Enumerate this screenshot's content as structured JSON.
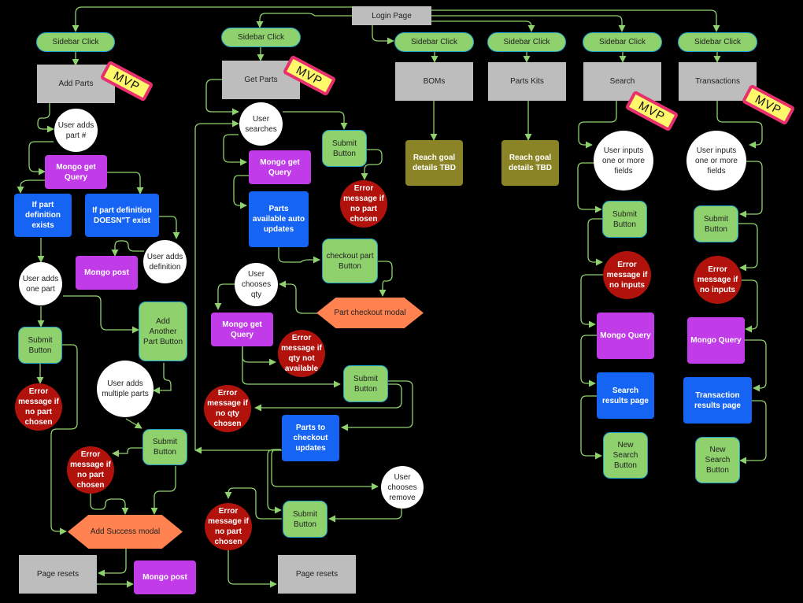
{
  "diagram": {
    "title": "Login Page",
    "colors": {
      "background": "#000000",
      "edge": "#8fd16c",
      "pill": "#8fd16c",
      "pill_border": "#1aa0c8",
      "page": "#bdbdbd",
      "mongo": "#c23be8",
      "blue": "#1664f4",
      "error": "#b1120c",
      "olive": "#8a8426",
      "modal": "#ff8250",
      "mvp_fill": "#fff86a",
      "mvp_border": "#e8306e"
    },
    "mvp_label": "MVP",
    "nodes": {
      "login": "Login Page",
      "sb1": "Sidebar Click",
      "sb2": "Sidebar Click",
      "sb3": "Sidebar Click",
      "sb4": "Sidebar Click",
      "sb5": "Sidebar Click",
      "sb6": "Sidebar Click",
      "add_parts": "Add Parts",
      "get_parts": "Get Parts",
      "boms": "BOMs",
      "parts_kits": "Parts Kits",
      "search": "Search",
      "transactions": "Transactions",
      "a_user_adds_part": "User adds part #",
      "a_mongo_get": "Mongo get Query",
      "a_if_exists": "If part definition exists",
      "a_if_not_exists": "If part definition DOESN\"T exist",
      "a_mongo_post1": "Mongo post",
      "a_user_adds_def": "User adds definition",
      "a_user_adds_one": "User adds one part",
      "a_submit1": "Submit Button",
      "a_add_another": "Add Another Part Button",
      "a_err1": "Error message if no part chosen",
      "a_user_adds_multi": "User adds multiple parts",
      "a_submit2": "Submit Button",
      "a_err2": "Error message if no part chosen",
      "a_success_modal": "Add Success modal",
      "a_page_resets": "Page resets",
      "a_mongo_post2": "Mongo post",
      "g_user_searches": "User searches",
      "g_submit1": "Submit Button",
      "g_err1": "Error message if no part chosen",
      "g_mongo_get1": "Mongo get Query",
      "g_parts_avail": "Parts available auto updates",
      "g_checkout_btn": "checkout part Button",
      "g_user_qty": "User chooses qty",
      "g_checkout_modal": "Part checkout modal",
      "g_mongo_get2": "Mongo get Query",
      "g_err_qty": "Error message if qty not available",
      "g_submit2": "Submit Button",
      "g_err_noqty": "Error message if no qty chosen",
      "g_parts_checkout": "Parts to checkout updates",
      "g_user_remove": "User chooses remove",
      "g_submit3": "Submit Button",
      "g_err3": "Error message if no part chosen",
      "g_page_resets": "Page resets",
      "b_goal": "Reach goal details TBD",
      "k_goal": "Reach goal details TBD",
      "s_inputs": "User inputs one or more fields",
      "s_submit": "Submit Button",
      "s_err": "Error message if no inputs",
      "s_mongo": "Mongo Query",
      "s_results": "Search results page",
      "s_new": "New Search Button",
      "t_inputs": "User inputs one or more fields",
      "t_submit": "Submit Button",
      "t_err": "Error message if no inputs",
      "t_mongo": "Mongo Query",
      "t_results": "Transaction results page",
      "t_new": "New Search Button"
    }
  }
}
